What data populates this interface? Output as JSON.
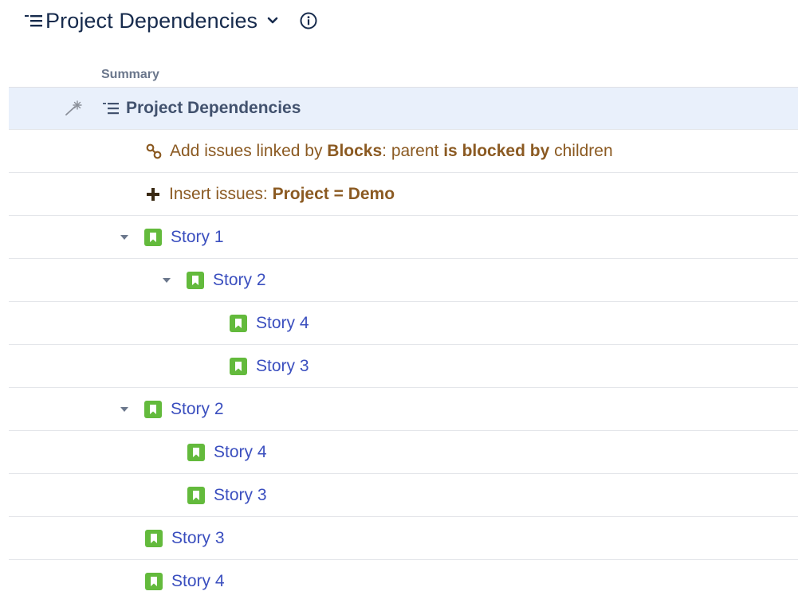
{
  "header": {
    "title": "Project Dependencies"
  },
  "columns": {
    "summary": "Summary"
  },
  "root": {
    "label": "Project Dependencies"
  },
  "generators": [
    {
      "prefix": "Add issues linked by ",
      "link_type": "Blocks",
      "mid": ": parent ",
      "relation": "is blocked by",
      "suffix": " children"
    },
    {
      "prefix": "Insert issues: ",
      "query": "Project = Demo"
    }
  ],
  "issues": [
    {
      "label": "Story 1",
      "depth": 0,
      "expanded": true
    },
    {
      "label": "Story 2",
      "depth": 1,
      "expanded": true
    },
    {
      "label": "Story 4",
      "depth": 2,
      "expanded": null
    },
    {
      "label": "Story 3",
      "depth": 2,
      "expanded": null
    },
    {
      "label": "Story 2",
      "depth": 0,
      "expanded": true
    },
    {
      "label": "Story 4",
      "depth": 1,
      "expanded": null
    },
    {
      "label": "Story 3",
      "depth": 1,
      "expanded": null
    },
    {
      "label": "Story 3",
      "depth": 0,
      "expanded": null
    },
    {
      "label": "Story 4",
      "depth": 0,
      "expanded": null
    }
  ],
  "colors": {
    "link": "#3b4fbf",
    "generator_text": "#8b5a22",
    "story_icon": "#63ba3c",
    "selected_row": "#e9f0fb"
  },
  "icons": {
    "structure": "structure-icon",
    "chevron": "chevron-down-icon",
    "info": "info-icon",
    "wand": "magic-wand-icon",
    "link": "link-icon",
    "insert": "plus-icon",
    "story": "story-icon",
    "expand": "expand-triangle-icon"
  }
}
